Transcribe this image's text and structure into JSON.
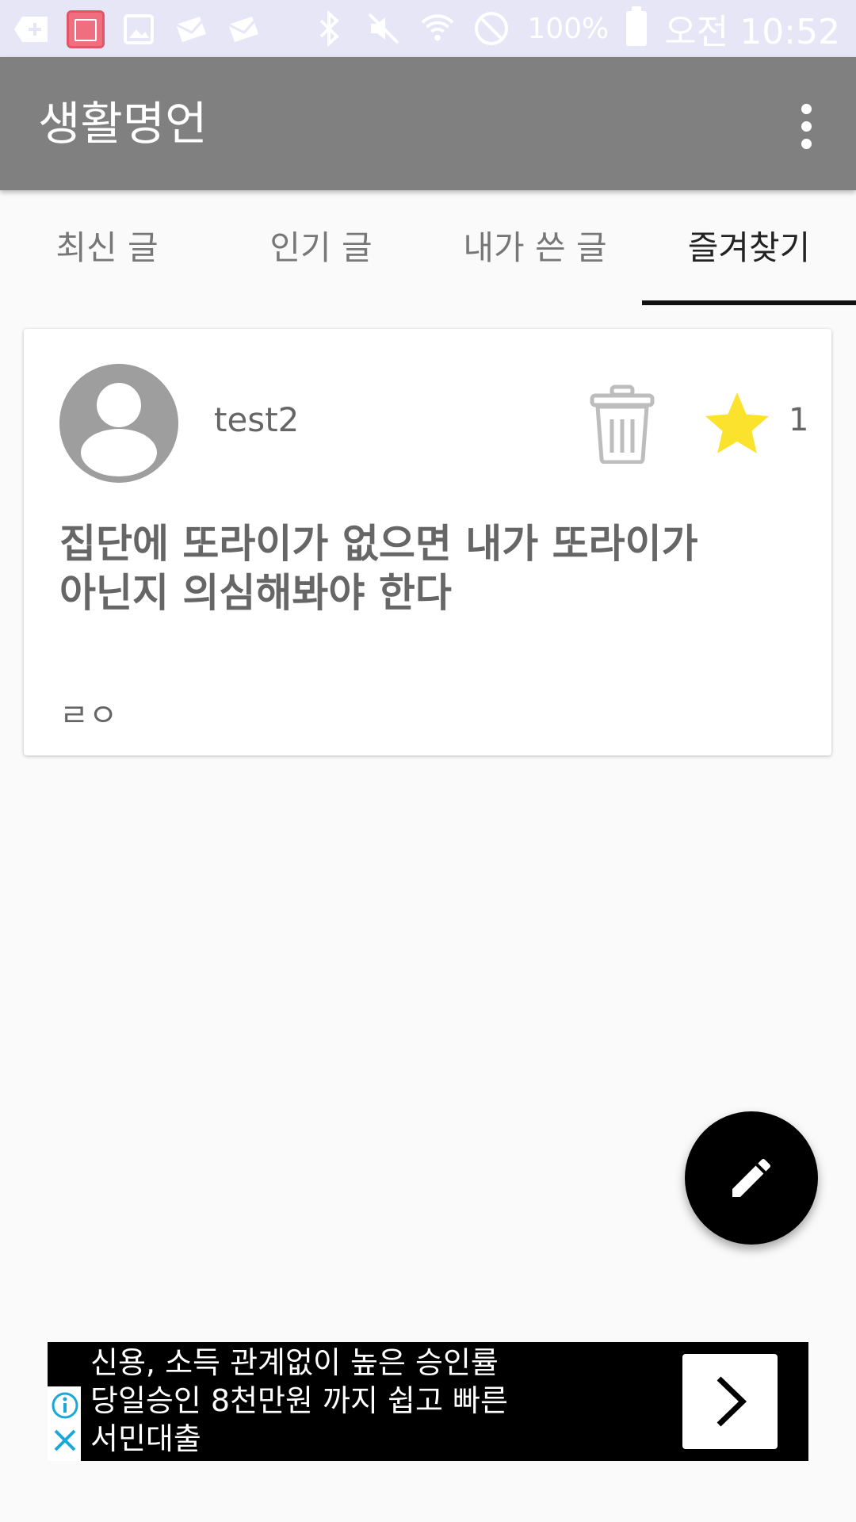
{
  "status_bar": {
    "battery": "100%",
    "time": "오전 10:52",
    "icons": [
      "add-icon",
      "wise-saying-app-icon",
      "image-icon",
      "mail-heart-icon",
      "mail-heart-icon",
      "bluetooth-icon",
      "mute-icon",
      "wifi-icon",
      "do-not-disturb-icon",
      "battery-icon"
    ]
  },
  "app_bar": {
    "title": "생활명언",
    "menu_icon": "more-vert-icon"
  },
  "tabs": [
    {
      "label": "최신 글",
      "active": false
    },
    {
      "label": "인기 글",
      "active": false
    },
    {
      "label": "내가 쓴 글",
      "active": false
    },
    {
      "label": "즐겨찾기",
      "active": true
    }
  ],
  "post": {
    "author": "test2",
    "favorite_count": "1",
    "quote_line1": "집단에 또라이가 없으면 내가 또라이가",
    "quote_line2": "아닌지 의심해봐야 한다",
    "comment": "ㄹㅇ",
    "icons": [
      "avatar-icon",
      "trash-icon",
      "star-icon"
    ]
  },
  "fab": {
    "icon": "edit-icon"
  },
  "ad": {
    "line1": "신용, 소득 관계없이 높은 승인률",
    "line2": "당일승인 8천만원 까지 쉽고 빠른",
    "line3": "서민대출",
    "icons": [
      "info-icon",
      "close-icon",
      "chevron-right-icon"
    ]
  },
  "colors": {
    "app_bar": "#808080",
    "status_bar": "#e6e6f7",
    "star": "#fbe22d",
    "fab": "#000000"
  }
}
